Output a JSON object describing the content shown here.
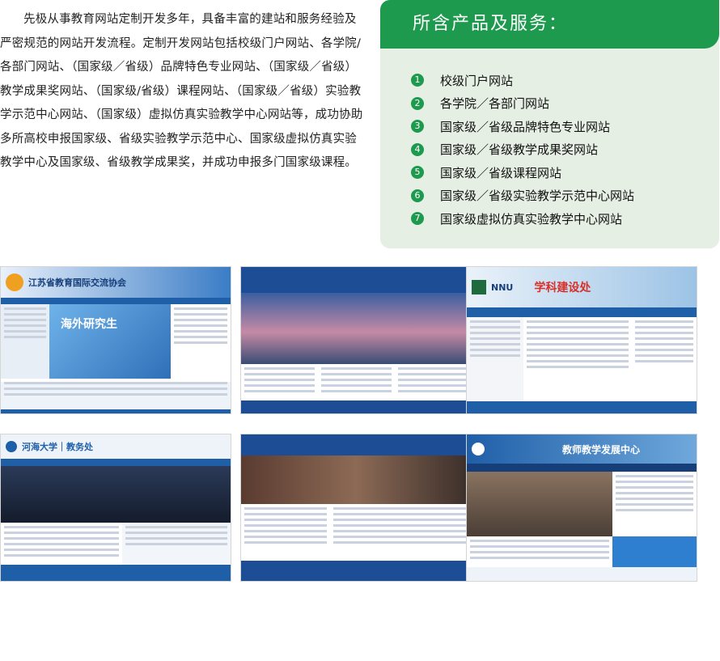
{
  "intro_text": "先极从事教育网站定制开发多年，具备丰富的建站和服务经验及严密规范的网站开发流程。定制开发网站包括校级门户网站、各学院/各部门网站、（国家级／省级）品牌特色专业网站、（国家级／省级）教学成果奖网站、（国家级/省级）课程网站、（国家级／省级）实验教学示范中心网站、（国家级）虚拟仿真实验教学中心网站等，成功协助多所高校申报国家级、省级实验教学示范中心、国家级虚拟仿真实验教学中心及国家级、省级教学成果奖，并成功申报多门国家级课程。",
  "services": {
    "title": "所含产品及服务：",
    "items": [
      {
        "num": "1",
        "label": "校级门户网站"
      },
      {
        "num": "2",
        "label": "各学院／各部门网站"
      },
      {
        "num": "3",
        "label": "国家级／省级品牌特色专业网站"
      },
      {
        "num": "4",
        "label": "国家级／省级教学成果奖网站"
      },
      {
        "num": "5",
        "label": "国家级／省级课程网站"
      },
      {
        "num": "6",
        "label": "国家级／省级实验教学示范中心网站"
      },
      {
        "num": "7",
        "label": "国家级虚拟仿真实验教学中心网站"
      }
    ]
  },
  "thumbnails": [
    {
      "banner": "江苏省教育国际交流协会",
      "hero": "海外研究生"
    },
    {
      "banner": "",
      "hero": ""
    },
    {
      "banner": "NNU",
      "hero": "学科建设处"
    },
    {
      "banner": "河海大学｜教务处",
      "hero": ""
    },
    {
      "banner": "",
      "hero": ""
    },
    {
      "banner": "教师教学发展中心",
      "hero": ""
    }
  ],
  "colors": {
    "accent": "#1d9a4e",
    "panel_bg": "#e6efe4",
    "site_blue": "#1f5fa8"
  }
}
